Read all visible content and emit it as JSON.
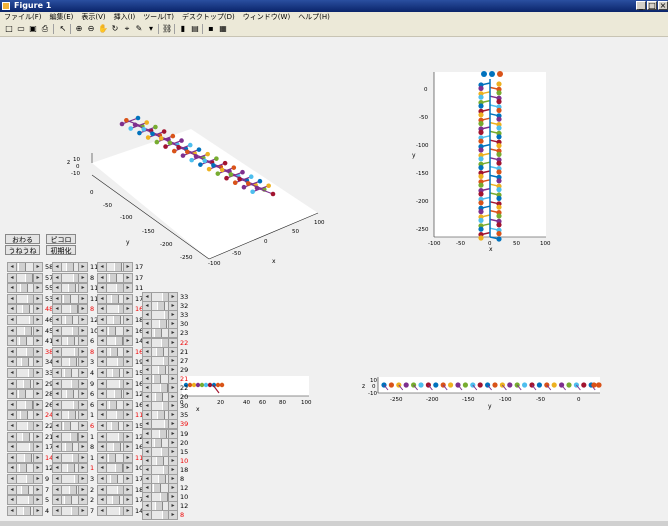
{
  "window": {
    "title": "Figure 1"
  },
  "menu": [
    "ファイル(F)",
    "編集(E)",
    "表示(V)",
    "挿入(I)",
    "ツール(T)",
    "デスクトップ(D)",
    "ウィンドウ(W)",
    "ヘルプ(H)"
  ],
  "buttons": {
    "b1": "おわる",
    "b2": "ピコロ",
    "b3": "うねうね",
    "b4": "初期化"
  },
  "columns": [
    [
      "58",
      "57",
      "55",
      "53",
      "48",
      "46",
      "45",
      "41",
      "38",
      "34",
      "33",
      "29",
      "28",
      "26",
      "24",
      "22",
      "21",
      "17",
      "14",
      "12",
      "9",
      "7",
      "5",
      "4",
      "1"
    ],
    [
      "11",
      "8",
      "11",
      "11",
      "8",
      "12",
      "10",
      "6",
      "8",
      "3",
      "4",
      "9",
      "6",
      "6",
      "1",
      "6",
      "1",
      "8",
      "1",
      "1",
      "3",
      "2",
      "2",
      "7",
      "6"
    ],
    [
      "17",
      "17",
      "11",
      "17",
      "16",
      "18",
      "16",
      "14",
      "16",
      "19",
      "15",
      "16",
      "12",
      "16",
      "11",
      "15",
      "12",
      "16",
      "11",
      "10",
      "17",
      "18",
      "17",
      "14",
      "12"
    ],
    [
      "33",
      "32",
      "33",
      "30",
      "23",
      "22",
      "21",
      "27",
      "29",
      "21",
      "22",
      "20",
      "30",
      "35",
      "39",
      "19",
      "20",
      "15",
      "10",
      "18",
      "8",
      "12",
      "10",
      "12",
      "8"
    ]
  ],
  "axes3d": {
    "zlabel": "z",
    "ylabel": "y",
    "xlabel": "x",
    "zticks": [
      "10",
      "0",
      "-10"
    ],
    "yticks": [
      "0",
      "-50",
      "-100",
      "-150",
      "-200",
      "-250"
    ],
    "xticks": [
      "100",
      "50",
      "0",
      "-50",
      "-100"
    ]
  },
  "topview": {
    "ylabel": "y",
    "xlabel": "x",
    "yticks": [
      "0",
      "-50",
      "-100",
      "-150",
      "-200",
      "-250"
    ],
    "xticks": [
      "-100",
      "-50",
      "0",
      "50",
      "100"
    ]
  },
  "xzview": {
    "xlabel": "x",
    "yticks": [
      "10",
      "0",
      "-10"
    ],
    "xticks": [
      "0",
      "20",
      "40",
      "60",
      "80",
      "100"
    ]
  },
  "yzview": {
    "ylabel": "z",
    "xlabel": "y",
    "yticks": [
      "10",
      "0",
      "-10"
    ],
    "xticks": [
      "-250",
      "-200",
      "-150",
      "-100",
      "-50",
      "0"
    ]
  },
  "colors": [
    "#0072BD",
    "#D95319",
    "#EDB120",
    "#7E2F8E",
    "#77AC30",
    "#4DBEEE",
    "#A2142F"
  ]
}
